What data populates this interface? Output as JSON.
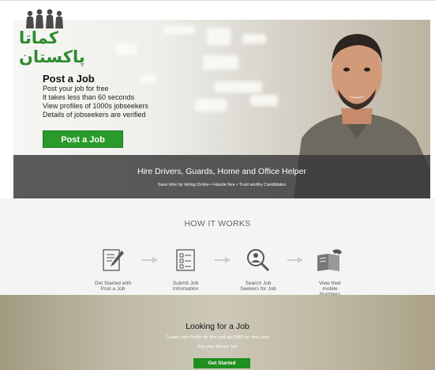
{
  "logo": {
    "text": "کماتا پاکستان"
  },
  "hero": {
    "title": "Post a Job",
    "lines": [
      "Post your job for free",
      "It takes less than 60 seconds",
      "View profiles of 1000s jobseekers",
      "Details of jobseekers are verified"
    ],
    "button": "Post a Job",
    "banner_title": "Hire Drivers, Guards, Home and Office Helper",
    "banner_sub": "Save time by Hiring Online • Hassle free • Trust worthy Candidates"
  },
  "how": {
    "title": "HOW IT WORKS",
    "steps": [
      {
        "label_1": "Get Started with",
        "label_2": "Post a Job",
        "label_3": "",
        "icon": "write-document-icon"
      },
      {
        "label_1": "Submit Job",
        "label_2": "Information",
        "label_3": "",
        "icon": "checklist-icon"
      },
      {
        "label_1": "Search Job",
        "label_2": "Seekers for Job",
        "label_3": "",
        "icon": "search-person-icon"
      },
      {
        "label_1": "View their",
        "label_2": "mobile",
        "label_3": "Numbers",
        "icon": "phone-book-icon"
      }
    ]
  },
  "looking": {
    "title": "Looking for a Job",
    "sub_1": "Create your Profile for free and get SMS for new Jobs",
    "sub_2": "find your Dream Job",
    "button": "Get Started"
  },
  "colors": {
    "accent_green": "#2a9a2a",
    "banner": "#373737",
    "section_bg": "#f4f4f4"
  }
}
